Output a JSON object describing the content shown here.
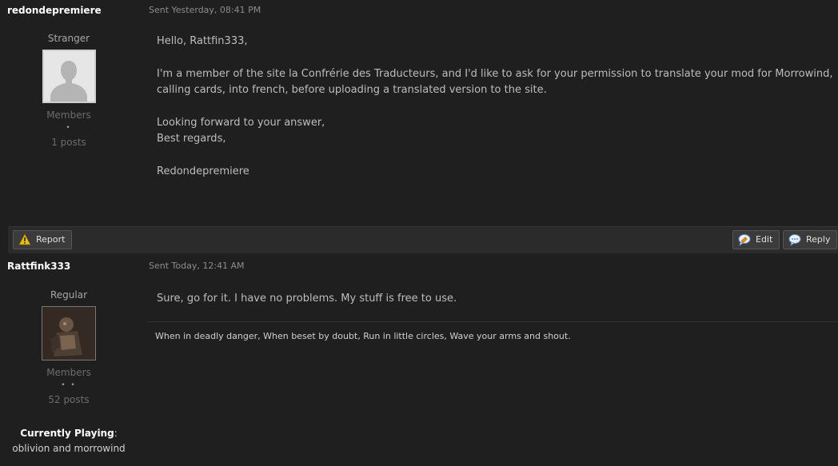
{
  "posts": [
    {
      "author": "redondepremiere",
      "date": "Sent Yesterday, 08:41 PM",
      "rank": "Stranger",
      "group": "Members",
      "pips": "•",
      "post_count": "1 posts",
      "body": [
        "Hello, Rattfin333,",
        "I'm a member of the site la Confrérie des Traducteurs, and I'd like to ask for your permission to translate your mod for Morrowind,",
        "calling cards, into french, before uploading a translated version to the site.",
        "Looking forward to your answer,",
        "Best regards,",
        "Redondepremiere"
      ],
      "actions": {
        "report": "Report",
        "edit": "Edit",
        "reply": "Reply"
      }
    },
    {
      "author": "Rattfink333",
      "date": "Sent Today, 12:41 AM",
      "rank": "Regular",
      "group": "Members",
      "pips": "• •",
      "post_count": "52 posts",
      "body": [
        "Sure, go for it. I have no problems. My stuff is free to use."
      ],
      "signature": "When in deadly danger, When beset by doubt, Run in little circles, Wave your arms and shout.",
      "currently_playing_label": "Currently Playing",
      "currently_playing_value": "oblivion and morrowind"
    }
  ],
  "icons": {
    "report": "warning-icon",
    "edit": "edit-icon",
    "reply": "reply-icon"
  },
  "colors": {
    "background": "#1f1f1f",
    "author": "#ffffff",
    "warning": "#e8c21c",
    "edit_reply": "#5a8fd6"
  }
}
